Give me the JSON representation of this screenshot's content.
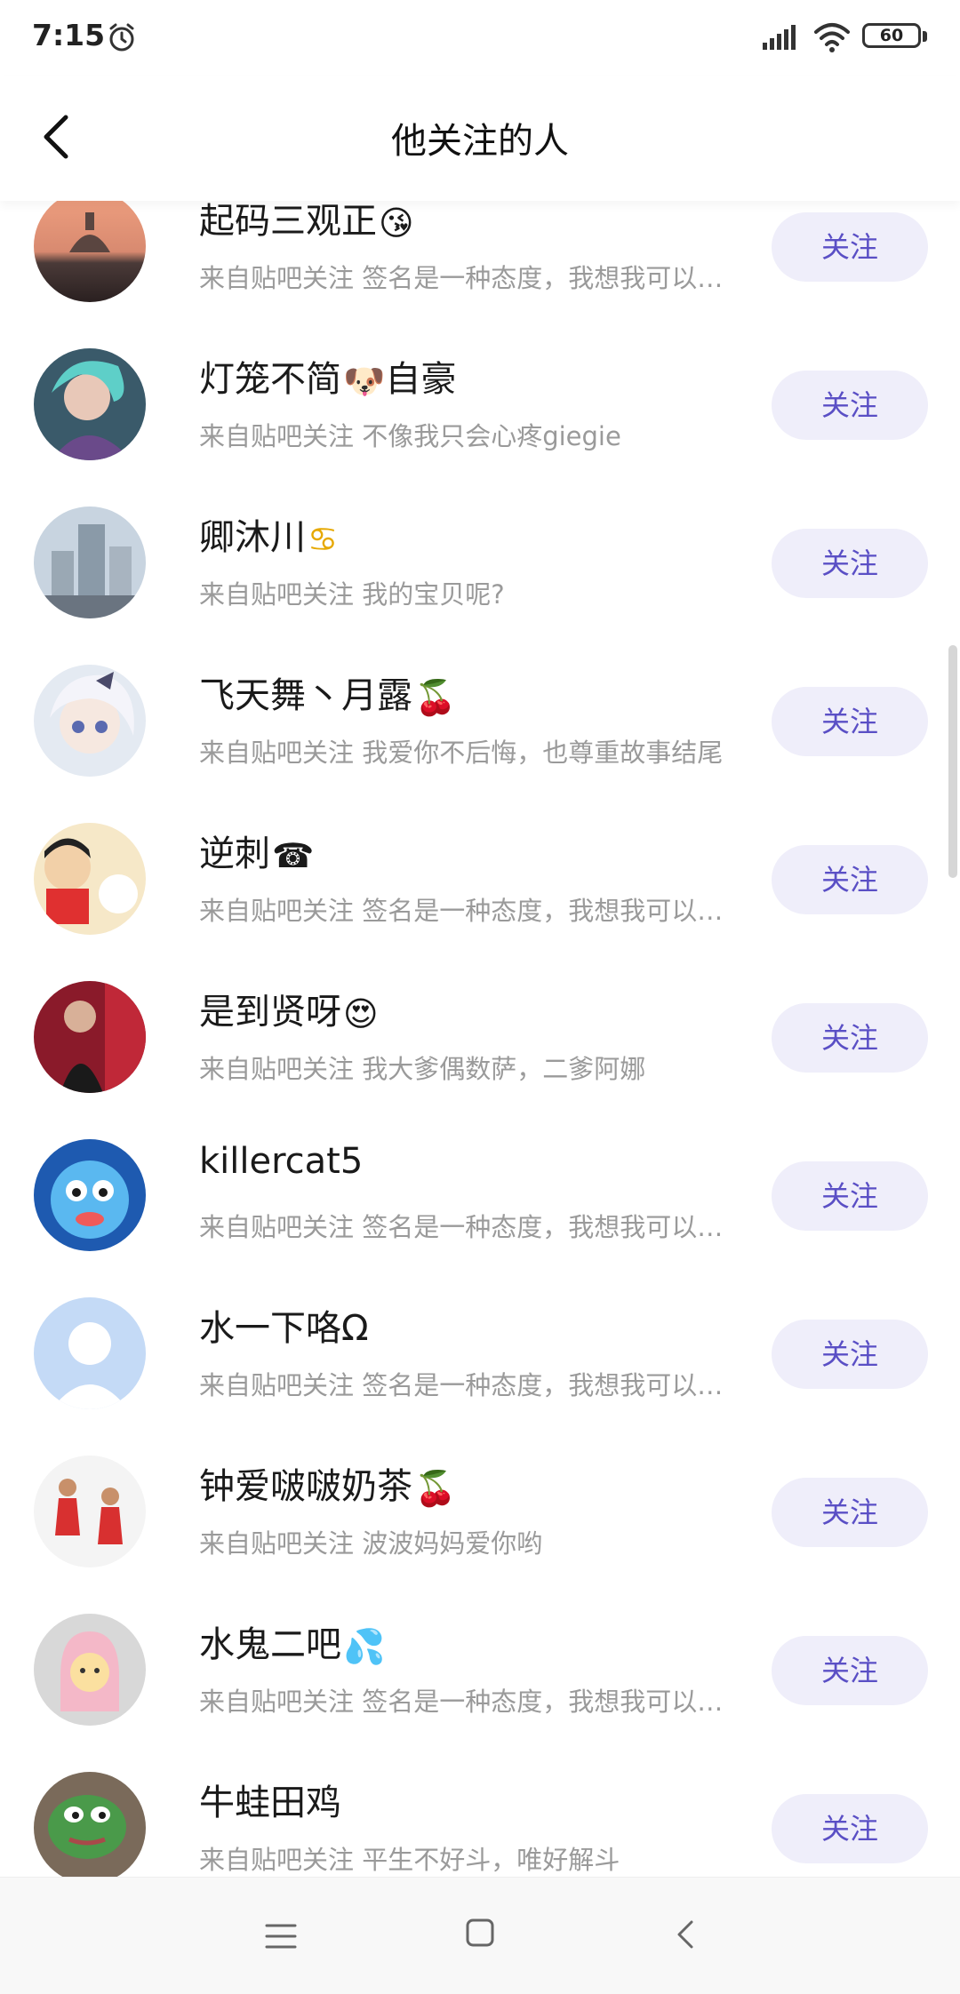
{
  "status_bar": {
    "time": "7:15",
    "battery": "60"
  },
  "header": {
    "title": "他关注的人"
  },
  "users": [
    {
      "name": "起码三观正",
      "emoji": "😘",
      "desc": "来自贴吧关注 签名是一种态度，我想我可以…",
      "button": "关注"
    },
    {
      "name": "灯笼不简",
      "emoji": "🐶",
      "name_suffix": "自豪",
      "desc": "来自贴吧关注 不像我只会心疼giegie",
      "button": "关注"
    },
    {
      "name": "卿沐川",
      "emoji": "♋",
      "desc": "来自贴吧关注 我的宝贝呢?",
      "button": "关注"
    },
    {
      "name": "飞天舞丶月露",
      "emoji": "🍒",
      "desc": "来自贴吧关注 我爱你不后悔，也尊重故事结尾",
      "button": "关注"
    },
    {
      "name": "逆刺",
      "emoji": "☎",
      "desc": "来自贴吧关注 签名是一种态度，我想我可以…",
      "button": "关注"
    },
    {
      "name": "是到贤呀",
      "emoji": "😍",
      "desc": "来自贴吧关注 我大爹偶数萨，二爹阿娜",
      "button": "关注"
    },
    {
      "name": "killercat5",
      "emoji": "",
      "desc": "来自贴吧关注 签名是一种态度，我想我可以…",
      "button": "关注"
    },
    {
      "name": "水一下咯Ω",
      "emoji": "",
      "desc": "来自贴吧关注 签名是一种态度，我想我可以…",
      "button": "关注"
    },
    {
      "name": "钟爱啵啵奶茶",
      "emoji": "🍒",
      "desc": "来自贴吧关注 波波妈妈爱你哟",
      "button": "关注"
    },
    {
      "name": "水鬼二吧",
      "emoji": "💦",
      "desc": "来自贴吧关注 签名是一种态度，我想我可以…",
      "button": "关注"
    },
    {
      "name": "牛蛙田鸡",
      "emoji": "",
      "desc": "来自贴吧关注 平生不好斗，唯好解斗",
      "button": "关注"
    }
  ]
}
